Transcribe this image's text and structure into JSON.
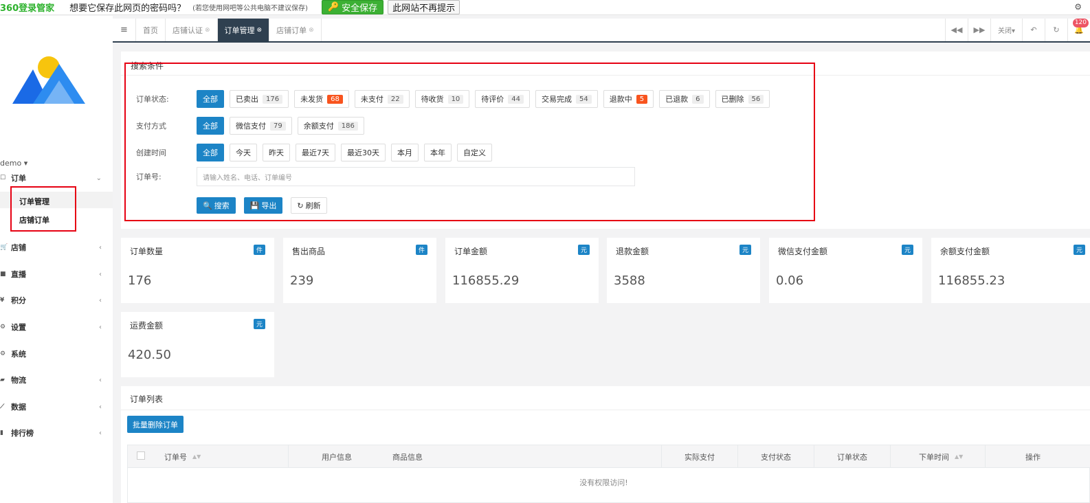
{
  "pwbar": {
    "logo": "360登录管家",
    "question": "想要它保存此网页的密码吗？",
    "hint": "(若您使用网吧等公共电脑不建议保存)",
    "save_label": "安全保存",
    "never_label": "此网站不再提示"
  },
  "sidebar": {
    "user": "demo ▾",
    "items": [
      {
        "label": "订单",
        "icon": "order-icon"
      },
      {
        "label": "店铺",
        "icon": "cart-icon"
      },
      {
        "label": "直播",
        "icon": "video-icon"
      },
      {
        "label": "积分",
        "icon": "yen-icon"
      },
      {
        "label": "设置",
        "icon": "gear-icon"
      },
      {
        "label": "系统",
        "icon": "cogs-icon"
      },
      {
        "label": "物流",
        "icon": "truck-icon"
      },
      {
        "label": "数据",
        "icon": "chart-icon"
      },
      {
        "label": "排行榜",
        "icon": "ranking-icon"
      }
    ],
    "subitems": [
      "订单管理",
      "店铺订单"
    ]
  },
  "tabs": [
    {
      "label": "首页",
      "closable": false
    },
    {
      "label": "店铺认证",
      "closable": true
    },
    {
      "label": "订单管理",
      "closable": true,
      "active": true
    },
    {
      "label": "店铺订单",
      "closable": true
    }
  ],
  "tools": {
    "close_label": "关闭▾",
    "notify_count": "120"
  },
  "search": {
    "title": "搜索条件",
    "status_label": "订单状态:",
    "status_options": [
      {
        "label": "全部",
        "count": "",
        "active": true
      },
      {
        "label": "已卖出",
        "count": "176"
      },
      {
        "label": "未发货",
        "count": "68",
        "hot": true
      },
      {
        "label": "未支付",
        "count": "22"
      },
      {
        "label": "待收货",
        "count": "10"
      },
      {
        "label": "待评价",
        "count": "44"
      },
      {
        "label": "交易完成",
        "count": "54"
      },
      {
        "label": "退款中",
        "count": "5",
        "hot": true
      },
      {
        "label": "已退款",
        "count": "6"
      },
      {
        "label": "已删除",
        "count": "56"
      }
    ],
    "pay_label": "支付方式",
    "pay_options": [
      {
        "label": "全部",
        "count": "",
        "active": true
      },
      {
        "label": "微信支付",
        "count": "79"
      },
      {
        "label": "余额支付",
        "count": "186"
      }
    ],
    "time_label": "创建时间",
    "time_options": [
      {
        "label": "全部",
        "active": true
      },
      {
        "label": "今天"
      },
      {
        "label": "昨天"
      },
      {
        "label": "最近7天"
      },
      {
        "label": "最近30天"
      },
      {
        "label": "本月"
      },
      {
        "label": "本年"
      },
      {
        "label": "自定义"
      }
    ],
    "order_no_label": "订单号:",
    "order_no_placeholder": "请输入姓名、电话、订单编号",
    "search_btn": "搜索",
    "export_btn": "导出",
    "refresh_btn": "刷新"
  },
  "stats": [
    {
      "title": "订单数量",
      "badge": "件",
      "value": "176"
    },
    {
      "title": "售出商品",
      "badge": "件",
      "value": "239"
    },
    {
      "title": "订单金额",
      "badge": "元",
      "value": "116855.29"
    },
    {
      "title": "退款金额",
      "badge": "元",
      "value": "3588"
    },
    {
      "title": "微信支付金额",
      "badge": "元",
      "value": "0.06"
    },
    {
      "title": "余额支付金额",
      "badge": "元",
      "value": "116855.23"
    },
    {
      "title": "运费金额",
      "badge": "元",
      "value": "420.50"
    }
  ],
  "list": {
    "title": "订单列表",
    "batch_delete": "批量删除订单",
    "columns": [
      "订单号",
      "用户信息",
      "商品信息",
      "实际支付",
      "支付状态",
      "订单状态",
      "下单时间",
      "操作"
    ],
    "empty": "没有权限访问!"
  }
}
